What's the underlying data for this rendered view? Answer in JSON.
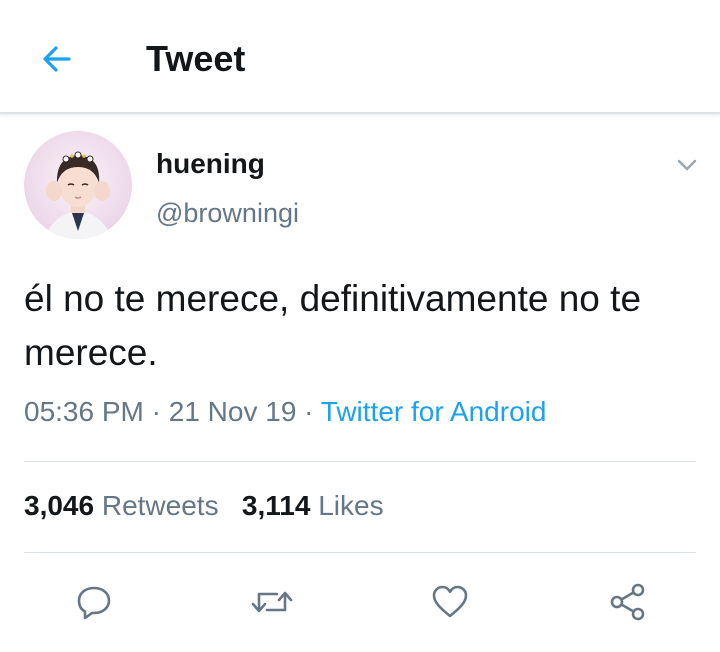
{
  "header": {
    "title": "Tweet",
    "back_icon": "arrow-left-icon",
    "accent_color": "#1da1f2"
  },
  "tweet": {
    "author": {
      "display_name": "huening",
      "handle": "@browningi",
      "avatar": "profile-photo"
    },
    "text": "él no te merece, definitivamente no te merece.",
    "time": "05:36 PM",
    "date": "21 Nov 19",
    "separator": "·",
    "source": "Twitter for Android",
    "menu_icon": "chevron-down-icon"
  },
  "stats": {
    "retweets_count": "3,046",
    "retweets_label": "Retweets",
    "likes_count": "3,114",
    "likes_label": "Likes"
  },
  "actions": [
    {
      "name": "reply",
      "icon": "reply-icon"
    },
    {
      "name": "retweet",
      "icon": "retweet-icon"
    },
    {
      "name": "like",
      "icon": "heart-icon"
    },
    {
      "name": "share",
      "icon": "share-icon"
    }
  ],
  "colors": {
    "text_primary": "#14171a",
    "text_secondary": "#657786",
    "link": "#1da1f2",
    "divider": "#d9dfe3"
  }
}
